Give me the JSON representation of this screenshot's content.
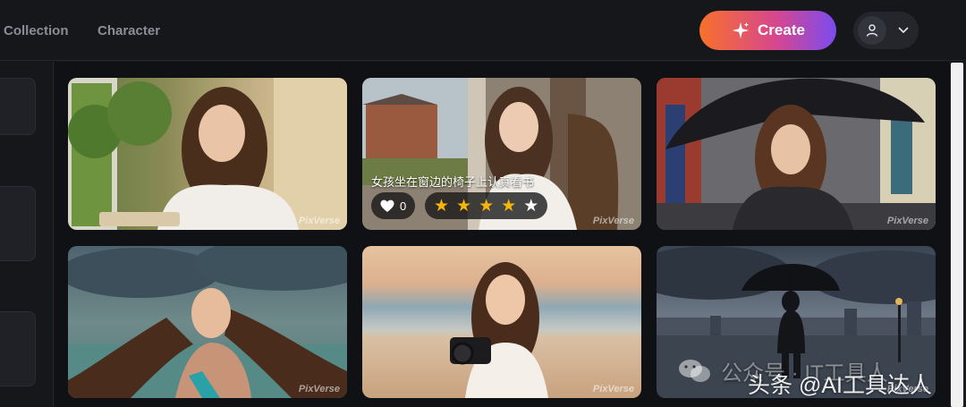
{
  "header": {
    "nav": [
      {
        "label": "Collection"
      },
      {
        "label": "Character"
      }
    ],
    "create_label": "Create"
  },
  "gallery": [
    {
      "watermark": "PixVerse"
    },
    {
      "watermark": "PixVerse",
      "title": "女孩坐在窗边的椅子上认真看书",
      "likes": "0",
      "rating": 4,
      "rating_max": 5
    },
    {
      "watermark": "PixVerse"
    },
    {
      "watermark": "PixVerse"
    },
    {
      "watermark": "PixVerse"
    },
    {
      "watermark": "PixVerse"
    }
  ],
  "overlay_watermark": {
    "account_faded": "公众号 · IT工具人",
    "brand": "头条 @AI工具达人"
  },
  "colors": {
    "accent_from": "#f7712b",
    "accent_to": "#7b4bf0",
    "star": "#f5b50a"
  }
}
